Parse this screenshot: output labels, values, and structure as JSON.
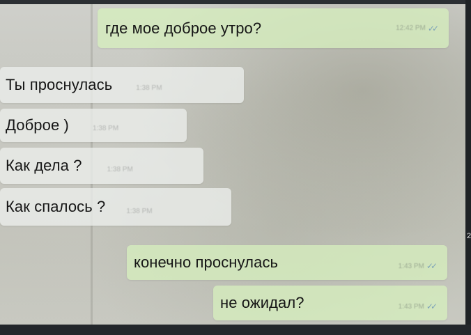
{
  "chat": {
    "messages": [
      {
        "direction": "out",
        "text": "где мое доброе утро?",
        "time": "12:42 PM",
        "status": "read"
      },
      {
        "direction": "in",
        "text": "Ты проснулась",
        "time": "1:38 PM"
      },
      {
        "direction": "in",
        "text": "Доброе )",
        "time": "1:38 PM"
      },
      {
        "direction": "in",
        "text": "Как дела ?",
        "time": "1:38 PM"
      },
      {
        "direction": "in",
        "text": "Как спалось ?",
        "time": "1:38 PM"
      },
      {
        "direction": "out",
        "text": "конечно проснулась",
        "time": "1:43 PM",
        "status": "read"
      },
      {
        "direction": "out",
        "text": "не ожидал?",
        "time": "1:43 PM",
        "status": "read"
      }
    ],
    "read_tick_icon": "double-check-icon",
    "read_tick_glyph": "✓✓",
    "edge_mark": "2"
  },
  "colors": {
    "outgoing_bubble": "#d6eebe",
    "incoming_bubble": "#eceeec",
    "read_tick": "#7fa4b8"
  }
}
